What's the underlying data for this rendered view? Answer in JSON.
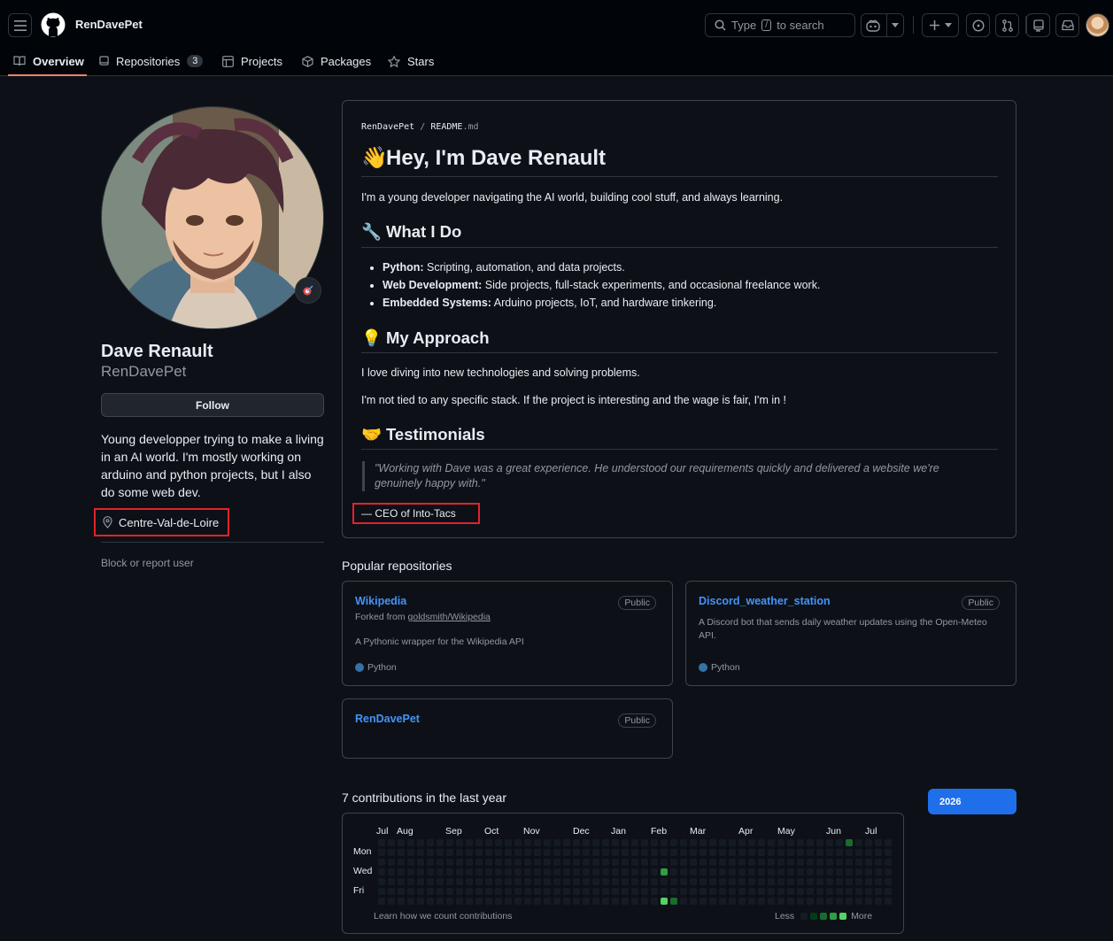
{
  "header": {
    "username": "RenDavePet",
    "search_placeholder_parts": [
      "Type",
      "/",
      "to search"
    ]
  },
  "tabs": [
    {
      "label": "Overview"
    },
    {
      "label": "Repositories",
      "count": "3"
    },
    {
      "label": "Projects"
    },
    {
      "label": "Packages"
    },
    {
      "label": "Stars"
    }
  ],
  "profile": {
    "name": "Dave Renault",
    "login": "RenDavePet",
    "follow_label": "Follow",
    "bio": "Young developper trying to make a living in an AI world. I'm mostly working on arduino and python projects, but I also do some web dev.",
    "location": "Centre-Val-de-Loire",
    "block_label": "Block or report user"
  },
  "readme": {
    "path_user": "RenDavePet",
    "path_sep": "/",
    "path_file": "README",
    "path_ext": ".md",
    "h1_emoji": "👋",
    "h1": "Hey, I'm Dave Renault",
    "intro": "I'm a young developer navigating the AI world, building cool stuff, and always learning.",
    "what_emoji": "🔧",
    "what_title": "What I Do",
    "what_items": [
      {
        "bold": "Python:",
        "text": " Scripting, automation, and data projects."
      },
      {
        "bold": "Web Development:",
        "text": " Side projects, full-stack experiments, and occasional freelance work."
      },
      {
        "bold": "Embedded Systems:",
        "text": " Arduino projects, IoT, and hardware tinkering."
      }
    ],
    "approach_emoji": "💡",
    "approach_title": "My Approach",
    "approach_p1": "I love diving into new technologies and solving problems.",
    "approach_p2": "I'm not tied to any specific stack. If the project is interesting and the wage is fair, I'm in !",
    "testimonials_emoji": "🤝",
    "testimonials_title": "Testimonials",
    "quote": "\"Working with Dave was a great experience. He understood our requirements quickly and delivered a website we're genuinely happy with.\"",
    "quote_author": "— CEO of Into-Tacs"
  },
  "popular": {
    "title": "Popular repositories",
    "repos": [
      {
        "name": "Wikipedia",
        "visibility": "Public",
        "fork_prefix": "Forked from ",
        "fork_source": "goldsmith/Wikipedia",
        "description": "A Pythonic wrapper for the Wikipedia API",
        "language": "Python"
      },
      {
        "name": "Discord_weather_station",
        "visibility": "Public",
        "description": "A Discord bot that sends daily weather updates using the Open-Meteo API.",
        "language": "Python"
      },
      {
        "name": "RenDavePet",
        "visibility": "Public"
      }
    ]
  },
  "contributions": {
    "title": "7 contributions in the last year",
    "year": "2026",
    "months": [
      "Jul",
      "Aug",
      "Sep",
      "Oct",
      "Nov",
      "Dec",
      "Jan",
      "Feb",
      "Mar",
      "Apr",
      "May",
      "Jun",
      "Jul"
    ],
    "days": [
      "Mon",
      "Wed",
      "Fri"
    ],
    "learn": "Learn how we count contributions",
    "less": "Less",
    "more": "More",
    "colors": [
      "#151b23",
      "#033a16",
      "#196c2e",
      "#2ea043",
      "#56d364"
    ],
    "active_cells": [
      {
        "week": 29,
        "day": 3,
        "level": 3
      },
      {
        "week": 29,
        "day": 6,
        "level": 4
      },
      {
        "week": 30,
        "day": 6,
        "level": 2
      },
      {
        "week": 48,
        "day": 0,
        "level": 2
      }
    ]
  }
}
